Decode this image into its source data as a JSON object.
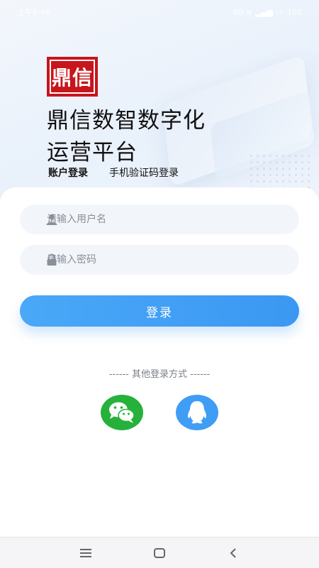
{
  "status_bar": {
    "time": "上午9:46",
    "indicators": "4G ≋ ▂▄▆ ▭",
    "battery": "100"
  },
  "branding": {
    "logo_text": "鼎信",
    "title_line1": "鼎信数智数字化",
    "title_line2": "运营平台"
  },
  "tabs": {
    "account_login": "账户登录",
    "phone_login": "手机验证码登录"
  },
  "form": {
    "username_placeholder": "请输入用户名",
    "password_placeholder": "请输入密码",
    "login_label": "登录"
  },
  "other_login": {
    "label": "------ 其他登录方式 ------",
    "options": [
      "wechat-icon",
      "qq-icon"
    ]
  },
  "colors": {
    "accent": "#3b98f2",
    "wechat": "#26b23a",
    "qq": "#3f9df5",
    "logo": "#c8141b"
  }
}
